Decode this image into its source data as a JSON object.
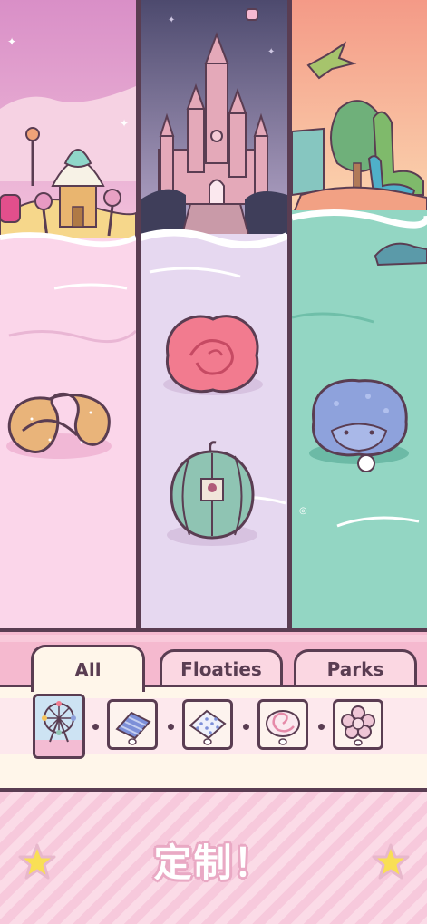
{
  "tabs": [
    {
      "label": "All",
      "active": true
    },
    {
      "label": "Floaties",
      "active": false
    },
    {
      "label": "Parks",
      "active": false
    }
  ],
  "tray_items": [
    {
      "name": "ferris-wheel-park",
      "selected": true
    },
    {
      "name": "blue-striped-float",
      "selected": false
    },
    {
      "name": "dotted-float",
      "selected": false
    },
    {
      "name": "swirl-candy-float",
      "selected": false
    },
    {
      "name": "flower-float",
      "selected": false
    }
  ],
  "panels": [
    {
      "theme": "candy-land",
      "floatie": "pretzel"
    },
    {
      "theme": "castle",
      "floatie": "rose-and-pumpkin"
    },
    {
      "theme": "dinosaur",
      "floatie": "triceratops"
    }
  ],
  "customize_label": "定制！",
  "colors": {
    "outline": "#5a3d52",
    "candy_water": "#fbd6ea",
    "castle_water": "#e6d8f0",
    "dino_water": "#93d6c3",
    "accent_pink": "#f5b9cf",
    "star": "#f9df55"
  }
}
